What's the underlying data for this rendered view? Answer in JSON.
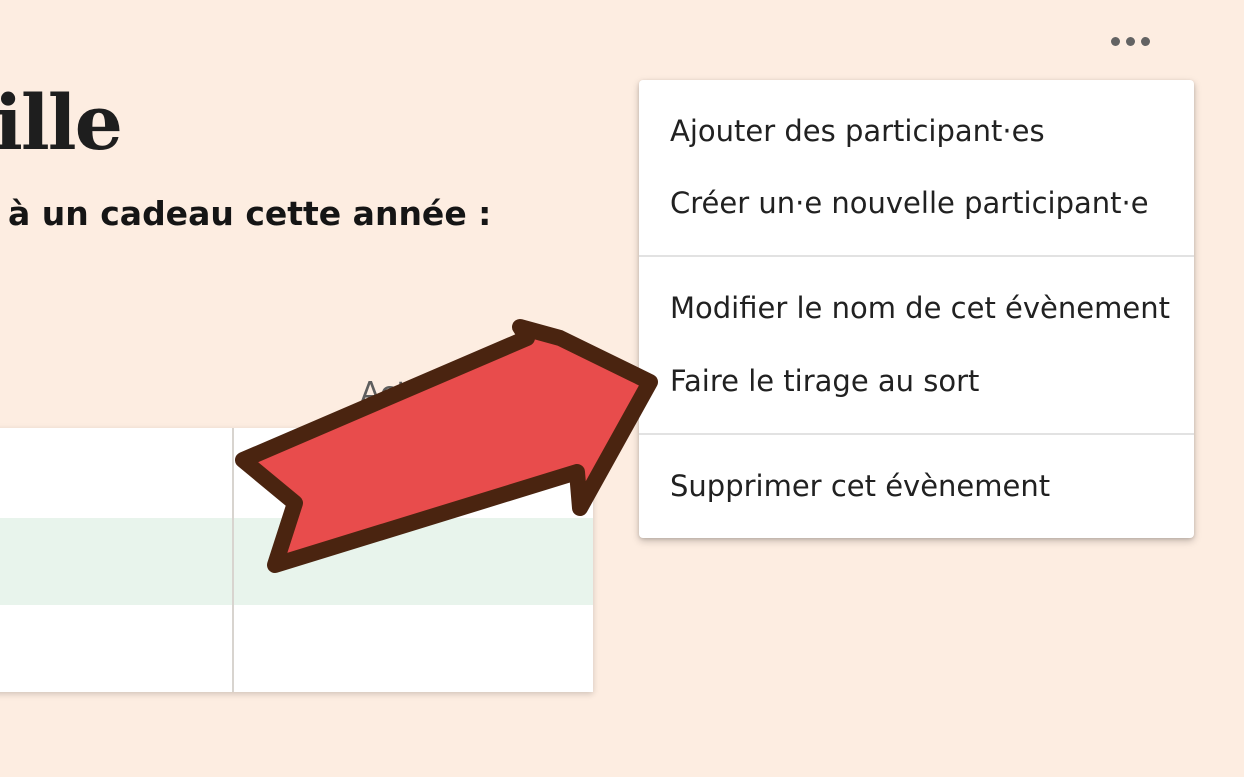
{
  "page": {
    "title": "ille",
    "subtitle": "à un cadeau cette année :"
  },
  "table": {
    "actions_header": "Actions"
  },
  "toolbar": {
    "more_icon": "more-horizontal-icon"
  },
  "menu": {
    "items": [
      {
        "label": "Ajouter des participant·es"
      },
      {
        "label": "Créer un·e nouvelle participant·e"
      },
      {
        "label": "Modifier le nom de cet évènement"
      },
      {
        "label": "Faire le tirage au sort"
      },
      {
        "label": "Supprimer cet évènement"
      }
    ]
  },
  "annotation": {
    "arrow_icon": "red-arrow-icon",
    "arrow_fill": "#e84c4c",
    "arrow_outline": "#4a2410"
  },
  "colors": {
    "background": "#fdede1",
    "highlight_row": "#e8f4ec"
  }
}
